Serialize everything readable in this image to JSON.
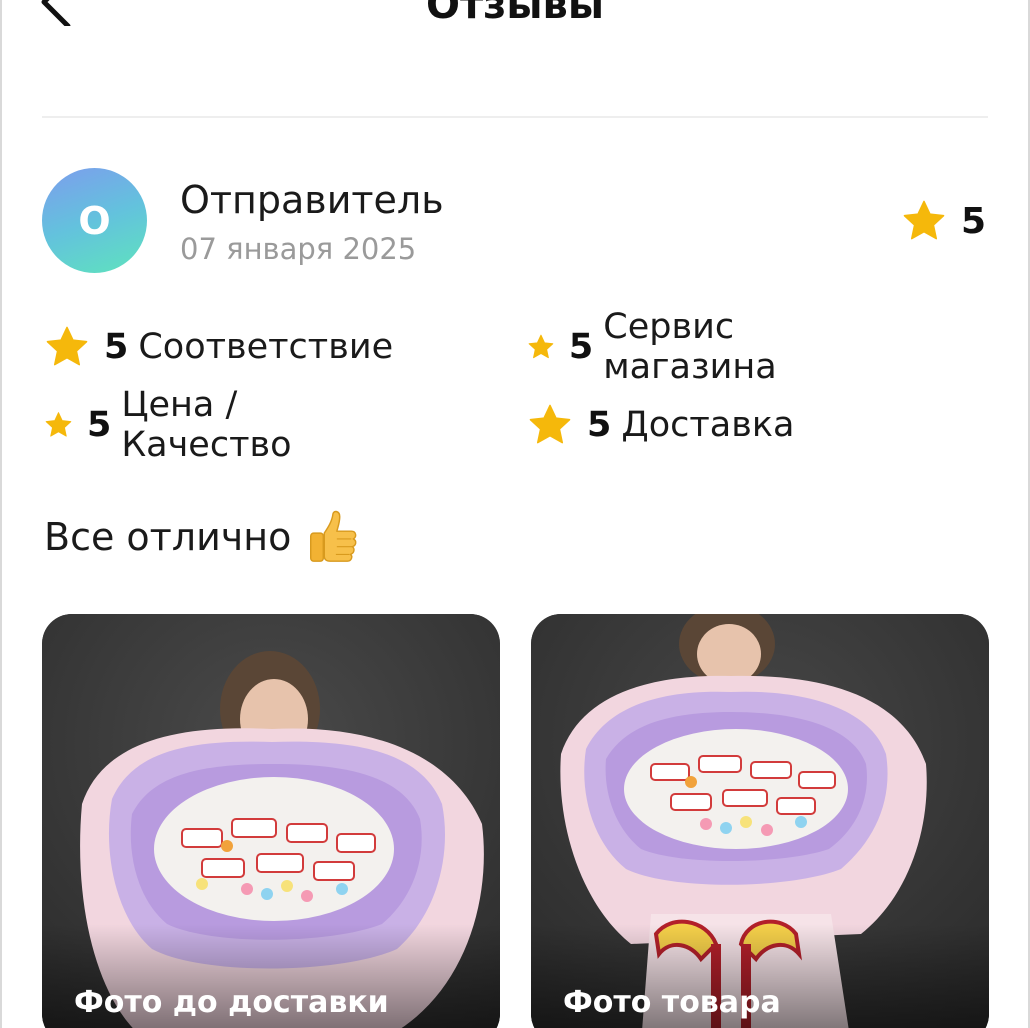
{
  "header": {
    "title": "Отзывы"
  },
  "review": {
    "avatar_letter": "О",
    "author": "Отправитель",
    "date": "07 января 2025",
    "overall_score": "5",
    "criteria": [
      {
        "score": "5",
        "label": "Соответствие"
      },
      {
        "score": "5",
        "label": "Сервис магазина"
      },
      {
        "score": "5",
        "label": "Цена / Качество"
      },
      {
        "score": "5",
        "label": "Доставка"
      }
    ],
    "text": "Все отлично",
    "photos": [
      {
        "caption": "Фото до доставки"
      },
      {
        "caption": "Фото товара"
      }
    ]
  },
  "colors": {
    "star": "#F5B80B",
    "divider": "#EEEEEE",
    "muted_text": "#9A9A9A",
    "avatar_gradient": [
      "#7D9DED",
      "#5FE3BD"
    ]
  },
  "icons": {
    "back": "chevron-left-icon",
    "star": "star-icon",
    "thumb": "thumbs-up-icon"
  }
}
